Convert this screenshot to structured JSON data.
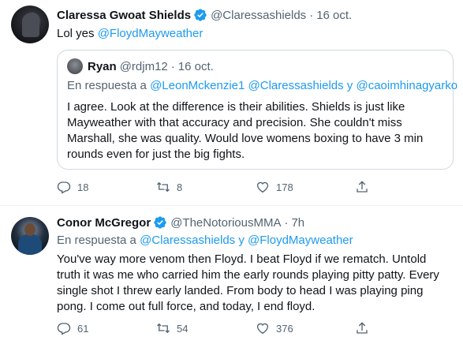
{
  "tweets": [
    {
      "name": "Claressa Gwoat Shields",
      "handle": "@Claressashields",
      "sep": "·",
      "date": "16 oct.",
      "text_prefix": "Lol yes ",
      "text_mention": "@FloydMayweather",
      "quoted": {
        "name": "Ryan",
        "handle": "@rdjm12",
        "sep": "·",
        "date": "16 oct.",
        "reply_prefix": "En respuesta a ",
        "reply_mentions": "@LeonMckenzie1 @Claressashields y @caoimhinagyarko",
        "text": "I agree. Look at the difference is their abilities. Shields is just like Mayweather with that accuracy and precision. She couldn't miss Marshall, she was quality. Would love womens boxing to have 3 min rounds even for just the big fights."
      },
      "replies": "18",
      "retweets": "8",
      "likes": "178"
    },
    {
      "name": "Conor McGregor",
      "handle": "@TheNotoriousMMA",
      "sep": "·",
      "date": "7h",
      "reply_prefix": "En respuesta a ",
      "reply_mentions": "@Claressashields y @FloydMayweather",
      "text": "You've way more venom then Floyd. I beat Floyd if we rematch. Untold truth it was me who carried him the early rounds playing pitty patty. Every single shot I threw early landed. From body to head I was playing ping pong. I come out full force, and today, I end floyd.",
      "replies": "61",
      "retweets": "54",
      "likes": "376"
    }
  ],
  "colors": {
    "accent": "#1d9bf0",
    "muted": "#536471",
    "text": "#0f1419",
    "border": "#cfd9de"
  },
  "icons": [
    "verified-badge-icon",
    "reply-icon",
    "retweet-icon",
    "like-icon",
    "share-icon"
  ]
}
